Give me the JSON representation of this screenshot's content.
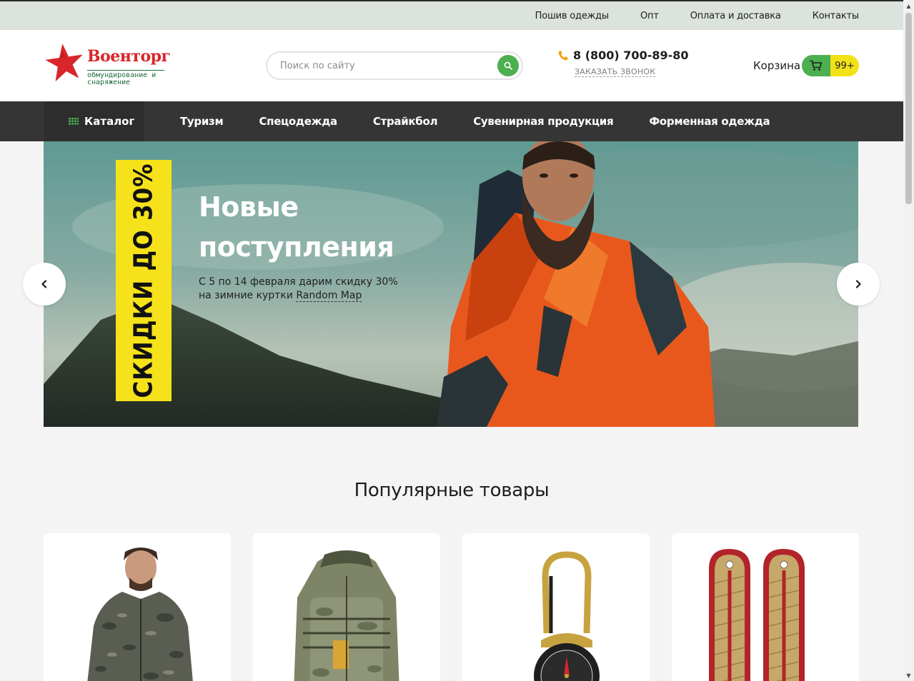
{
  "topbar": {
    "links": [
      {
        "label": "Пошив одежды"
      },
      {
        "label": "Опт"
      },
      {
        "label": "Оплата и доставка"
      },
      {
        "label": "Контакты"
      }
    ]
  },
  "header": {
    "logo": {
      "brand": "Военторг",
      "tagline": "обмундирование и снаряжение",
      "icon": "red-star-icon"
    },
    "search": {
      "placeholder": "Поиск по сайту",
      "value": "",
      "button_icon": "search-icon"
    },
    "phone": {
      "number": "8 (800) 700-89-80",
      "callback": "ЗАКАЗАТЬ ЗВОНОК",
      "icon": "phone-icon"
    },
    "cart": {
      "label": "Корзина",
      "count": "99+",
      "icon": "cart-icon"
    }
  },
  "nav": {
    "catalog": {
      "label": "Каталог",
      "icon": "grid-icon"
    },
    "items": [
      {
        "label": "Туризм"
      },
      {
        "label": "Спецодежда"
      },
      {
        "label": "Страйкбол"
      },
      {
        "label": "Сувенирная продукция"
      },
      {
        "label": "Форменная одежда"
      }
    ]
  },
  "hero": {
    "promo": "СКИДКИ ДО 30%",
    "title_line1": "Новые",
    "title_line2": "поступления",
    "subtitle_text": "С 5 по 14 февраля дарим скидку 30% на зимние куртки ",
    "subtitle_link": "Random Map",
    "prev_icon": "chevron-left-icon",
    "next_icon": "chevron-right-icon"
  },
  "popular": {
    "title": "Популярные товары",
    "products": [
      {
        "image": "camo-jacket-image"
      },
      {
        "image": "tactical-backpack-image"
      },
      {
        "image": "carabiner-compass-image"
      },
      {
        "image": "shoulder-boards-image"
      }
    ]
  },
  "colors": {
    "accent_green": "#4caf50",
    "promo_yellow": "#f5e21a",
    "brand_red": "#d8262b",
    "topbar_bg": "#dbe3dc",
    "nav_bg": "#353535"
  }
}
